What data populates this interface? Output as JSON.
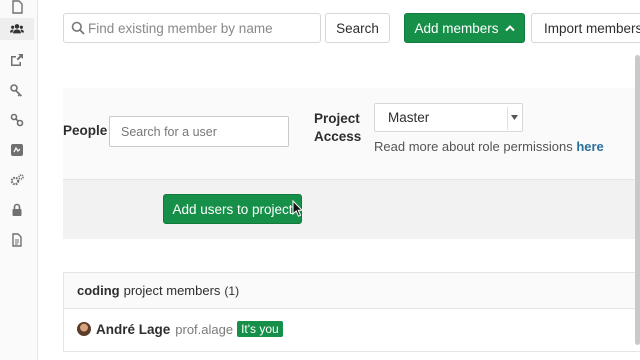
{
  "toolbar": {
    "search_placeholder": "Find existing member by name",
    "search_button": "Search",
    "add_members_button": "Add members",
    "import_members_button": "Import members"
  },
  "add_form": {
    "people_label": "People",
    "user_search_placeholder": "Search for a user",
    "project_access_label_line1": "Project",
    "project_access_label_line2": "Access",
    "access_selected": "Master",
    "read_more_text": "Read more about role permissions ",
    "read_more_link": "here",
    "add_users_button": "Add users to project"
  },
  "members": {
    "project_name": "coding",
    "heading_suffix": "project members",
    "count": "(1)",
    "rows": [
      {
        "name": "André Lage",
        "handle": "prof.alage",
        "badge": "It's you"
      }
    ]
  },
  "sidebar": {
    "icons": [
      "document-icon",
      "users-icon",
      "share-icon",
      "key-icon",
      "link-icon",
      "ci-icon",
      "gears-icon",
      "lock-icon",
      "file-icon"
    ]
  },
  "colors": {
    "primary_green": "#168f48",
    "link_blue": "#2b6f9c"
  }
}
